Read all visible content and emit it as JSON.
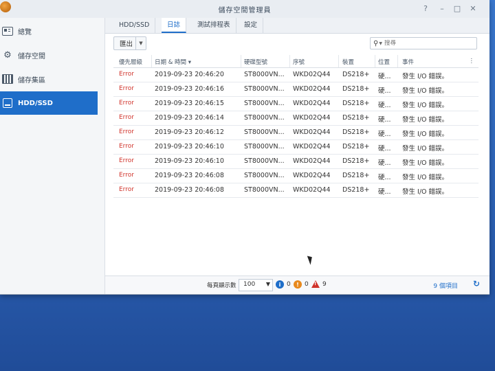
{
  "window": {
    "title": "儲存空間管理員",
    "controls": [
      "?",
      "–",
      "□",
      "✕"
    ]
  },
  "sidebar": {
    "items": [
      {
        "label": "總覽",
        "icon": "overview-icon"
      },
      {
        "label": "儲存空間",
        "icon": "storage-volume-icon"
      },
      {
        "label": "儲存集區",
        "icon": "storage-pool-icon"
      },
      {
        "label": "HDD/SSD",
        "icon": "hdd-icon",
        "active": true
      }
    ]
  },
  "tabs": [
    {
      "label": "HDD/SSD"
    },
    {
      "label": "日誌",
      "active": true
    },
    {
      "label": "測試排程表"
    },
    {
      "label": "設定"
    }
  ],
  "toolbar": {
    "export_label": "匯出",
    "search_placeholder": "搜尋"
  },
  "grid": {
    "columns": [
      "優先層級",
      "日期 & 時間 ▾",
      "硬碟型號",
      "序號",
      "裝置",
      "位置",
      "事件"
    ],
    "rows": [
      [
        "Error",
        "2019-09-23 20:46:20",
        "ST8000VN...",
        "WKD02Q44",
        "DS218+",
        "硬...",
        "發生 I/O 錯誤。"
      ],
      [
        "Error",
        "2019-09-23 20:46:16",
        "ST8000VN...",
        "WKD02Q44",
        "DS218+",
        "硬...",
        "發生 I/O 錯誤。"
      ],
      [
        "Error",
        "2019-09-23 20:46:15",
        "ST8000VN...",
        "WKD02Q44",
        "DS218+",
        "硬...",
        "發生 I/O 錯誤。"
      ],
      [
        "Error",
        "2019-09-23 20:46:14",
        "ST8000VN...",
        "WKD02Q44",
        "DS218+",
        "硬...",
        "發生 I/O 錯誤。"
      ],
      [
        "Error",
        "2019-09-23 20:46:12",
        "ST8000VN...",
        "WKD02Q44",
        "DS218+",
        "硬...",
        "發生 I/O 錯誤。"
      ],
      [
        "Error",
        "2019-09-23 20:46:10",
        "ST8000VN...",
        "WKD02Q44",
        "DS218+",
        "硬...",
        "發生 I/O 錯誤。"
      ],
      [
        "Error",
        "2019-09-23 20:46:10",
        "ST8000VN...",
        "WKD02Q44",
        "DS218+",
        "硬...",
        "發生 I/O 錯誤。"
      ],
      [
        "Error",
        "2019-09-23 20:46:08",
        "ST8000VN...",
        "WKD02Q44",
        "DS218+",
        "硬...",
        "發生 I/O 錯誤。"
      ],
      [
        "Error",
        "2019-09-23 20:46:08",
        "ST8000VN...",
        "WKD02Q44",
        "DS218+",
        "硬...",
        "發生 I/O 錯誤。"
      ]
    ]
  },
  "footer": {
    "per_page_label": "每頁顯示數",
    "per_page_value": "100",
    "info_count": "0",
    "warning_count": "0",
    "error_count": "9",
    "items_count": "9 個項目"
  },
  "colors": {
    "accent": "#1f6ec9",
    "error": "#d0332b",
    "warning": "#e8891d",
    "info": "#1f6ec9"
  }
}
